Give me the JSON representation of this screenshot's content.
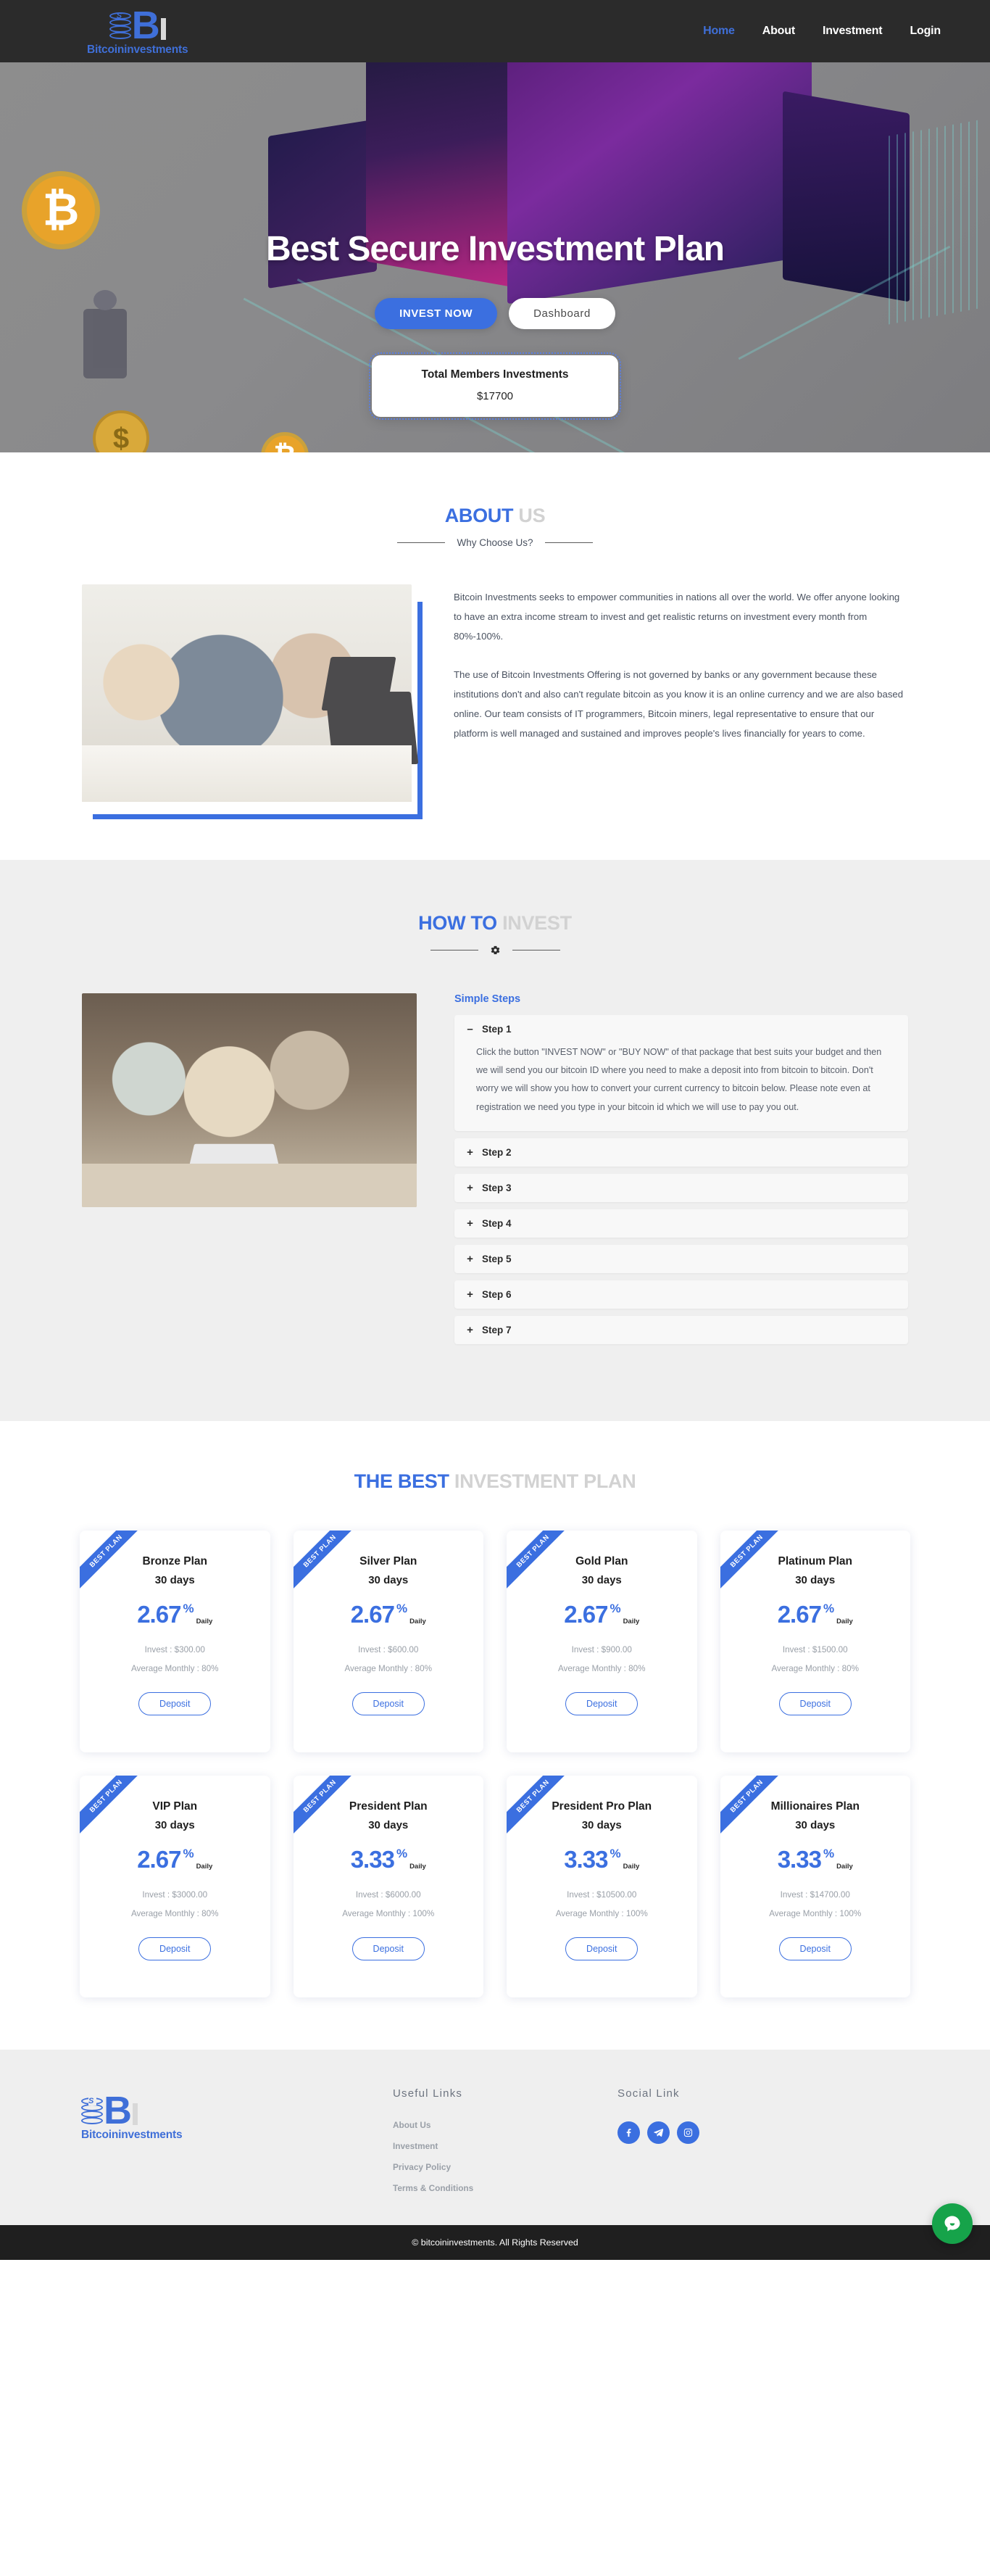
{
  "brand": {
    "name": "Bitcoininvestments",
    "letter": "B",
    "coin_symbol": "S",
    "accent": "#3b6fe0"
  },
  "nav": {
    "items": [
      {
        "label": "Home",
        "active": true
      },
      {
        "label": "About",
        "active": false
      },
      {
        "label": "Investment",
        "active": false
      },
      {
        "label": "Login",
        "active": false
      }
    ]
  },
  "hero": {
    "title": "Best Secure Investment Plan",
    "primary_button": "INVEST NOW",
    "secondary_button": "Dashboard",
    "members_label": "Total Members Investments",
    "members_value": "$17700",
    "bitcoin_glyph": "₿"
  },
  "about": {
    "title_hi": "ABOUT",
    "title_lo": "US",
    "subtitle": "Why Choose Us?",
    "paragraph1": "Bitcoin Investments seeks to empower communities in nations all over the world. We offer anyone looking to have an extra income stream to invest and get realistic returns on investment every month from 80%-100%.",
    "paragraph2": "The use of Bitcoin Investments Offering is not governed by banks or any government because these institutions don't and also can't regulate bitcoin as you know it is an online currency and we are also based online. Our team consists of IT programmers, Bitcoin miners, legal representative to ensure that our platform is well managed and sustained and improves people's lives financially for years to come."
  },
  "how": {
    "title_hi": "HOW TO",
    "title_lo": "INVEST",
    "steps_title": "Simple Steps",
    "steps": [
      {
        "label": "Step 1",
        "sign": "–",
        "open": true,
        "body": "Click the button \"INVEST NOW\" or \"BUY NOW\" of that package that best suits your budget and then we will send you our bitcoin ID where you need to make a deposit into from bitcoin to bitcoin. Don't worry we will show you how to convert your current currency to bitcoin below. Please note even at registration we need you type in your bitcoin id which we will use to pay you out."
      },
      {
        "label": "Step 2",
        "sign": "+",
        "open": false,
        "body": ""
      },
      {
        "label": "Step 3",
        "sign": "+",
        "open": false,
        "body": ""
      },
      {
        "label": "Step 4",
        "sign": "+",
        "open": false,
        "body": ""
      },
      {
        "label": "Step 5",
        "sign": "+",
        "open": false,
        "body": ""
      },
      {
        "label": "Step 6",
        "sign": "+",
        "open": false,
        "body": ""
      },
      {
        "label": "Step 7",
        "sign": "+",
        "open": false,
        "body": ""
      }
    ]
  },
  "plans_section": {
    "title_hi": "THE BEST",
    "title_lo": "INVESTMENT PLAN",
    "ribbon_label": "BEST PLAN",
    "deposit_label": "Deposit",
    "daily_label": "Daily",
    "percent_symbol": "%",
    "plans": [
      {
        "name": "Bronze Plan",
        "days": "30 days",
        "rate": "2.67",
        "invest": "Invest : $300.00",
        "avg": "Average Monthly : 80%"
      },
      {
        "name": "Silver Plan",
        "days": "30 days",
        "rate": "2.67",
        "invest": "Invest : $600.00",
        "avg": "Average Monthly : 80%"
      },
      {
        "name": "Gold Plan",
        "days": "30 days",
        "rate": "2.67",
        "invest": "Invest : $900.00",
        "avg": "Average Monthly : 80%"
      },
      {
        "name": "Platinum Plan",
        "days": "30 days",
        "rate": "2.67",
        "invest": "Invest : $1500.00",
        "avg": "Average Monthly : 80%"
      },
      {
        "name": "VIP Plan",
        "days": "30 days",
        "rate": "2.67",
        "invest": "Invest : $3000.00",
        "avg": "Average Monthly : 80%"
      },
      {
        "name": "President Plan",
        "days": "30 days",
        "rate": "3.33",
        "invest": "Invest : $6000.00",
        "avg": "Average Monthly : 100%"
      },
      {
        "name": "President Pro Plan",
        "days": "30 days",
        "rate": "3.33",
        "invest": "Invest : $10500.00",
        "avg": "Average Monthly : 100%"
      },
      {
        "name": "Millionaires Plan",
        "days": "30 days",
        "rate": "3.33",
        "invest": "Invest : $14700.00",
        "avg": "Average Monthly : 100%"
      }
    ]
  },
  "footer": {
    "useful_links_title": "Useful Links",
    "useful_links": [
      "About Us",
      "Investment",
      "Privacy Policy",
      "Terms & Conditions"
    ],
    "social_title": "Social Link",
    "social": [
      "facebook-icon",
      "telegram-icon",
      "instagram-icon"
    ],
    "copyright": "© bitcoininvestments. All Rights Reserved"
  },
  "chat": {
    "icon": "chat-bubble-icon",
    "color": "#16a34a"
  }
}
